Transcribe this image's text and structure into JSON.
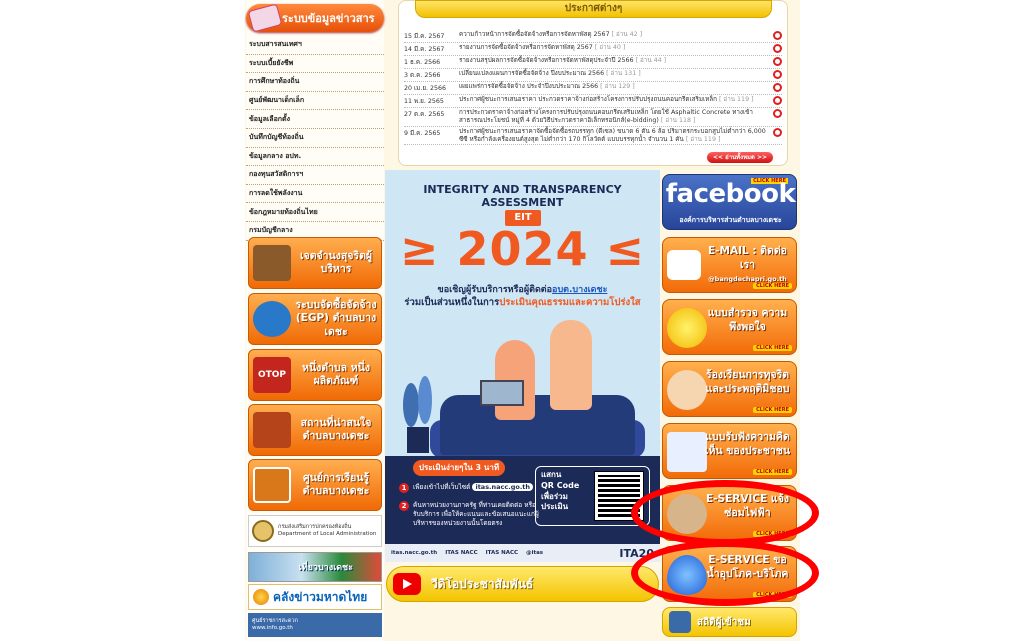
{
  "left": {
    "banner": "ระบบข้อมูลข่าวสาร",
    "menu": [
      "ระบบสารสนเทศฯ",
      "ระบบเบี้ยยังชีพ",
      "การศึกษาท้องถิ่น",
      "ศูนย์พัฒนาเด็กเล็ก",
      "ข้อมูลเลือกตั้ง",
      "บันทึกบัญชีท้องถิ่น",
      "ข้อมูลกลาง อปท.",
      "กองทุนสวัสดิการฯ",
      "การลดใช้พลังงาน",
      "ข้อกฎหมายท้องถิ่นไทย",
      "กรมบัญชีกลาง"
    ],
    "buttons": [
      {
        "label": "เจตจำนงสุจริตผู้บริหาร",
        "icon": "book-icon"
      },
      {
        "label": "ระบบจัดซื้อจัดจ้าง (EGP) ตำบลบางเดชะ",
        "icon": "egp-logo-icon"
      },
      {
        "label": "หนึ่งตำบล หนึ่งผลิตภัณฑ์",
        "icon": "otop-logo-icon",
        "icon_text": "OTOP"
      },
      {
        "label": "สถานที่น่าสนใจ ตำบลบางเดชะ",
        "icon": "travel-icon"
      },
      {
        "label": "ศูนย์การเรียนรู้ ตำบลบางเดชะ",
        "icon": "learning-center-icon"
      }
    ],
    "dla": {
      "line1": "กรมส่งเสริมการปกครองท้องถิ่น",
      "line2": "Department of Local Administration"
    },
    "pic_label": "เที่ยวบางเดชะ",
    "klang": "คลังข่าวมหาดไทย",
    "ocsc": {
      "line1": "ศูนย์ราชการสะดวก",
      "line2": "www.info.go.th"
    }
  },
  "news": {
    "header": "ประกาศต่างๆ",
    "read_all": "<< อ่านทั้งหมด >>",
    "items": [
      {
        "date": "15 มี.ค. 2567",
        "text": "ความก้าวหน้าการจัดซื้อจัดจ้างหรือการจัดหาพัสดุ 2567",
        "reads": "[ อ่าน 42 ]"
      },
      {
        "date": "14 มี.ค. 2567",
        "text": "รายงานการจัดซื้อจัดจ้างหรือการจัดหาพัสดุ 2567",
        "reads": "[ อ่าน 40 ]"
      },
      {
        "date": "1 ธ.ค. 2566",
        "text": "รายงานสรุปผลการจัดซื้อจัดจ้างหรือการจัดหาพัสดุประจำปี 2566",
        "reads": "[ อ่าน 44 ]"
      },
      {
        "date": "3 ต.ค. 2566",
        "text": "เปลี่ยนแปลงแผนการจัดซื้อจัดจ้าง ปีงบประมาณ 2566",
        "reads": "[ อ่าน 131 ]"
      },
      {
        "date": "20 เม.ย. 2566",
        "text": "เผยแพร่การจัดซื้อจัดจ้าง ประจำปีงบประมาณ 2566",
        "reads": "[ อ่าน 129 ]"
      },
      {
        "date": "11 พ.ย. 2565",
        "text": "ประกาศผู้ชนะการเสนอราคา ประกวดราคาจ้างก่อสร้างโครงการปรับปรุงถนนคอนกรีตเสริมเหล็ก",
        "reads": "[ อ่าน 119 ]"
      },
      {
        "date": "27 ต.ค. 2565",
        "text": "การประกวดราคาจ้างก่อสร้างโครงการปรับปรุงถนนคอนกรีตเสริมเหล็ก โดยใช้ Asphaltic Concrete ทางเข้าสาธารณประโยชน์ หมู่ที่ 4 ด้วยวิธีประกวดราคาอิเล็กทรอนิกส์(e-bidding)",
        "reads": "[ อ่าน 118 ]"
      },
      {
        "date": "9 มี.ค. 2565",
        "text": "ประกาศผู้ชนะการเสนอราคาจัดซื้อจัดซื้อรถบรรทุก (ดีเซล) ขนาด 6 ตัน 6 ล้อ ปริมาตรกระบอกสูบไม่ต่ำกว่า 6,000 ซีซี หรือกำลังเครื่องยนต์สูงสุด ไม่ต่ำกว่า 170 กิโลวัตต์ แบบบรรทุกน้ำ จำนวน 1 คัน",
        "reads": "[ อ่าน 119 ]"
      }
    ]
  },
  "poster": {
    "title1": "INTEGRITY AND TRANSPARENCY",
    "title2": "ASSESSMENT",
    "tag": "EIT",
    "year": "≥ 2024 ≤",
    "invite_pre": "ขอเชิญผู้รับบริการหรือผู้ติดต่อ",
    "invite_org": "อบต.บางเดชะ",
    "invite2_pre": "ร่วมเป็นส่วนหนึ่งในการ",
    "invite2_em": "ประเมินคุณธรรมและความโปร่งใส",
    "duration": "ประเมินง่ายๆใน 3 นาที",
    "step1_pre": "เพียงเข้าไปที่เว็บไซต์",
    "step1_url": "itas.nacc.go.th",
    "step2": "ค้นหาหน่วยงานภาครัฐ ที่ท่านเคยติดต่อ หรือรับบริการ เพื่อให้คะแนนและข้อเสนอแนะแก่ผู้บริหารของหน่วยงานนั้นโดยตรง",
    "qr_text": [
      "แสกน",
      "QR Code",
      "เพื่อร่วม",
      "ประเมิน"
    ],
    "social": [
      "itas.nacc.go.th",
      "ITAS NACC",
      "ITAS NACC",
      "@itas"
    ],
    "brand": "ITA20"
  },
  "video_label": "วีดิโอประชาสัมพันธ์",
  "right": {
    "facebook": {
      "word": "facebook",
      "sub": "องค์การบริหารส่วนตำบลบางเดชะ",
      "badge": "CLICK HERE"
    },
    "buttons": [
      {
        "label": "E-MAIL : ติดต่อเรา",
        "sub": "@bangdechapri.go.th",
        "icon": "email-icon",
        "badge": "CLICK HERE"
      },
      {
        "label": "แบบสำรวจ ความพึงพอใจ",
        "icon": "smiley-icon",
        "badge": "CLICK HERE"
      },
      {
        "label": "ร้องเรียนการทุจริต และประพฤติมิชอบ",
        "icon": "complaint-icon",
        "badge": "CLICK HERE"
      },
      {
        "label": "แบบรับฟังความคิดเห็น ของประชาชน",
        "icon": "survey-form-icon",
        "badge": "CLICK HERE"
      },
      {
        "label": "E-SERVICE แจ้งซ่อมไฟฟ้า",
        "icon": "electrician-icon",
        "badge": "CLICK HERE"
      },
      {
        "label": "E-SERVICE ขอน้ำอุปโภค-บริโภค",
        "icon": "water-drop-icon",
        "badge": "CLICK HERE"
      }
    ],
    "stats": "สถิติผู้เข้าชม"
  },
  "colors": {
    "accent_orange": "#f26b08",
    "highlight_ring": "#ff0000",
    "news_yellow": "#f4c400",
    "poster_navy": "#1c2a57"
  }
}
